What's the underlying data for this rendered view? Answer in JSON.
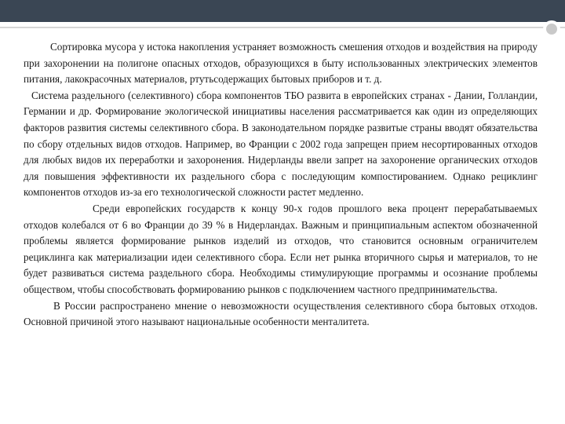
{
  "slide": {
    "paragraphs": [
      "Сортировка мусора у истока накопления устраняет возможность смешения отходов и воздействия на природу при захоронении на полигоне опасных отходов, образующихся в быту использованных электрических элементов питания, лакокрасочных материалов, ртутьсодержащих бытовых приборов и т. д.",
      "Система раздельного (селективного) сбора компонентов ТБО развита в европейских странах - Дании, Голландии, Германии и др. Формирование экологической инициативы населения рассматривается как один из определяющих факторов развития системы селективного сбора. В законодательном порядке развитые страны вводят обязательства по сбору отдельных видов отходов. Например, во Франции с 2002 года запрещен прием несортированных отходов для любых видов их переработки и захоронения. Нидерланды ввели запрет на захоронение органических отходов для повышения эффективности их раздельного сбора с последующим компостированием. Однако рециклинг компонентов отходов из-за его технологической сложности растет медленно.",
      "Среди европейских государств к концу 90-х годов прошлого века процент перерабатываемых отходов колебался от 6 во Франции до 39 % в Нидерландах. Важным и принципиальным аспектом обозначенной проблемы является формирование рынков изделий из отходов, что становится основным ограничителем рециклинга как материализации идеи селективного сбора. Если нет рынка вторичного сырья и материалов, то не будет развиваться система раздельного сбора. Необходимы стимулирующие программы и осознание проблемы обществом, чтобы способствовать формированию рынков с подключением частного предпринимательства.",
      "В России распространено мнение о невозможности осуществления селективного сбора бытовых отходов. Основной причиной этого называют национальные особенности менталитета."
    ]
  }
}
